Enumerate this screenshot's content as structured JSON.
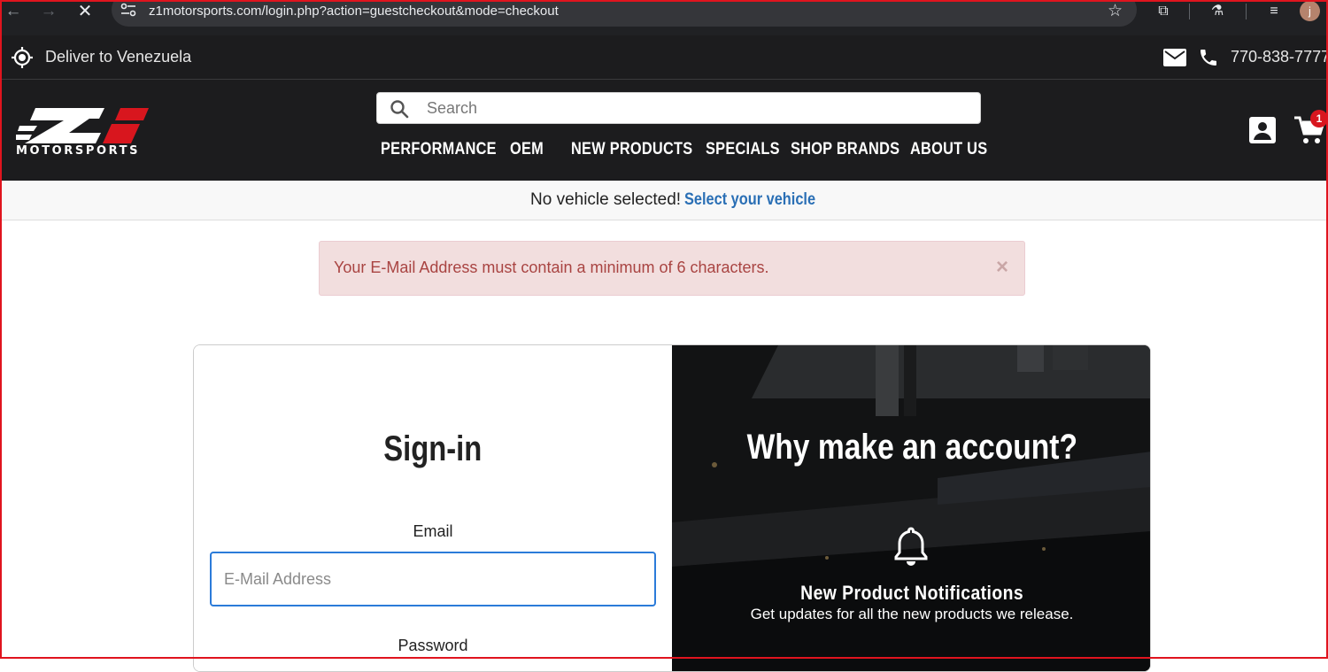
{
  "browser": {
    "url": "z1motorsports.com/login.php?action=guestcheckout&mode=checkout",
    "profile_initial": "j"
  },
  "utility": {
    "deliver_to": "Deliver to Venezuela",
    "phone": "770-838-7777"
  },
  "header": {
    "logo_text": "MOTORSPORTS",
    "search_placeholder": "Search",
    "cart_count": "1",
    "menu": [
      {
        "label": "PERFORMANCE"
      },
      {
        "label": "OEM"
      },
      {
        "label": "NEW PRODUCTS"
      },
      {
        "label": "SPECIALS"
      },
      {
        "label": "SHOP BRANDS"
      },
      {
        "label": "ABOUT US"
      }
    ]
  },
  "vehicle": {
    "status": "No vehicle selected!",
    "select_link": "Select your vehicle"
  },
  "alert": {
    "message": "Your E-Mail Address must contain a minimum of 6 characters.",
    "close": "×"
  },
  "signin": {
    "title": "Sign-in",
    "email_label": "Email",
    "email_placeholder": "E-Mail Address",
    "password_label": "Password"
  },
  "benefits": {
    "title": "Why make an account?",
    "feature_title": "New Product Notifications",
    "feature_desc": "Get updates for all the new products we release."
  },
  "colors": {
    "header_bg": "#1c1c1e",
    "brand_red": "#d8161e",
    "link_blue": "#2a6fb5",
    "alert_bg": "#f2dede",
    "alert_text": "#a94442"
  }
}
